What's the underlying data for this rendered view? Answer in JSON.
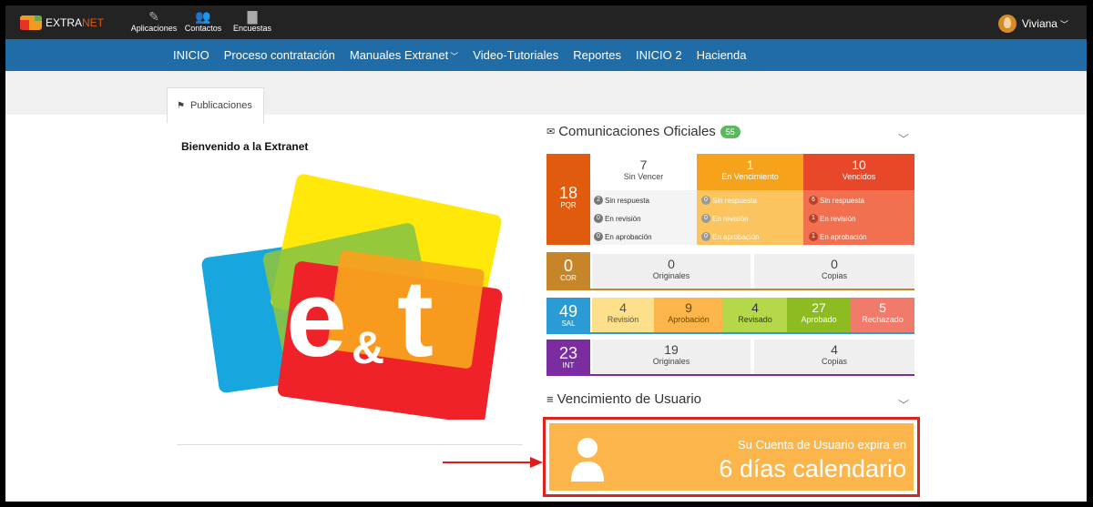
{
  "app": {
    "brand_prefix": "EXTRA",
    "brand_suffix": "NET",
    "logo_text": "et"
  },
  "top_icons": [
    {
      "label": "Aplicaciones",
      "icon": "pencil-icon"
    },
    {
      "label": "Contactos",
      "icon": "users-icon"
    },
    {
      "label": "Encuestas",
      "icon": "file-icon"
    }
  ],
  "user": {
    "name": "Viviana"
  },
  "nav": [
    "INICIO",
    "Proceso contratación",
    "Manuales Extranet",
    "Video-Tutoriales",
    "Reportes",
    "INICIO 2",
    "Hacienda"
  ],
  "tab": {
    "label": "Publicaciones"
  },
  "welcome": "Bienvenido a la Extranet",
  "comunicaciones": {
    "title": "Comunicaciones Oficiales",
    "badge": "55",
    "pqr": {
      "total": "18",
      "code": "PQR",
      "columns": [
        {
          "count": "7",
          "label": "Sin Vencer",
          "items": [
            {
              "n": "2",
              "t": "Sin respuesta"
            },
            {
              "n": "0",
              "t": "En revisión"
            },
            {
              "n": "0",
              "t": "En aprobación"
            }
          ]
        },
        {
          "count": "1",
          "label": "En Vencimiento",
          "items": [
            {
              "n": "0",
              "t": "Sin respuesta"
            },
            {
              "n": "0",
              "t": "En revisión"
            },
            {
              "n": "0",
              "t": "En aprobación"
            }
          ]
        },
        {
          "count": "10",
          "label": "Vencidos",
          "items": [
            {
              "n": "6",
              "t": "Sin respuesta"
            },
            {
              "n": "1",
              "t": "En revisión"
            },
            {
              "n": "1",
              "t": "En aprobación"
            }
          ]
        }
      ]
    },
    "cor": {
      "total": "0",
      "code": "COR",
      "originales": "0",
      "originales_label": "Originales",
      "copias": "0",
      "copias_label": "Copias"
    },
    "sal": {
      "total": "49",
      "code": "SAL",
      "items": [
        {
          "n": "4",
          "t": "Revisión"
        },
        {
          "n": "9",
          "t": "Aprobación"
        },
        {
          "n": "4",
          "t": "Revisado"
        },
        {
          "n": "27",
          "t": "Aprobado"
        },
        {
          "n": "5",
          "t": "Rechazado"
        }
      ]
    },
    "int": {
      "total": "23",
      "code": "INT",
      "originales": "19",
      "originales_label": "Originales",
      "copias": "4",
      "copias_label": "Copias"
    }
  },
  "vencimiento": {
    "title": "Vencimiento de Usuario",
    "message": "Su Cuenta de Usuario expira en",
    "days": "6 días calendario"
  },
  "colors": {
    "nav": "#1f6ca6",
    "pqr_head": "#e05b0e",
    "cor": "#c7852a",
    "sal": "#2b9bd6",
    "int": "#7a2ca0",
    "accent_box": "#fbb54a",
    "highlight": "#d9251d"
  }
}
